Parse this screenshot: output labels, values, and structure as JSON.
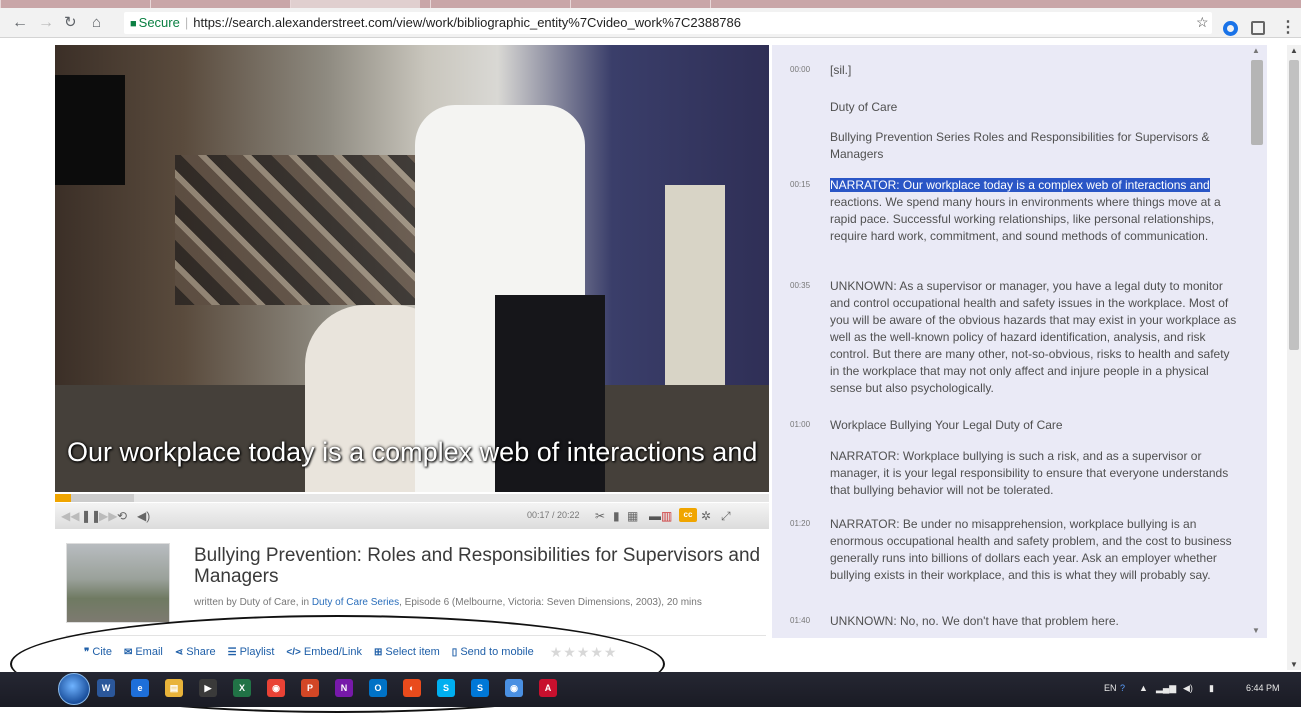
{
  "browser": {
    "secure_label": "Secure",
    "url": "https://search.alexanderstreet.com/view/work/bibliographic_entity%7Cvideo_work%7C2388786"
  },
  "video": {
    "subtitle": "Our workplace today is a complex web of interactions and",
    "progress": 0.0142,
    "buffered": 0.11,
    "time": "00:17 / 20:22",
    "cc_label": "cc"
  },
  "work": {
    "title": "Bullying Prevention: Roles and Responsibilities for Supervisors and Managers",
    "credit_prefix": "written by Duty of Care, in ",
    "series_link": "Duty of Care Series",
    "credit_suffix": ", Episode 6 (Melbourne, Victoria: Seven Dimensions, 2003), 20 mins"
  },
  "actions": {
    "cite": "Cite",
    "email": "Email",
    "share": "Share",
    "playlist": "Playlist",
    "embed": "Embed/Link",
    "select": "Select item",
    "mobile": "Send to mobile"
  },
  "rating": {
    "stars_filled": 0,
    "stars_total": 5
  },
  "transcript": [
    {
      "time": "00:00",
      "text": "[sil.]"
    },
    {
      "time": "",
      "text": "Duty of Care"
    },
    {
      "time": "",
      "text": "Bullying Prevention Series Roles and Responsibilities for Supervisors & Managers"
    },
    {
      "time": "00:15",
      "highlight": "NARRATOR: Our workplace today is a complex web of interactions and",
      "text": " reactions. We spend many hours in environments where things move at a rapid pace. Successful working relationships, like personal relationships, require hard work, commitment, and sound methods of communication."
    },
    {
      "time": "00:35",
      "text": "UNKNOWN: As a supervisor or manager, you have a legal duty to monitor and control occupational health and safety issues in the workplace. Most of you will be aware of the obvious hazards that may exist in your workplace as well as the well-known policy of hazard identification, analysis, and risk control. But there are many other, not-so-obvious, risks to health and safety in the workplace that may not only affect and injure people in a physical sense but also psychologically."
    },
    {
      "time": "01:00",
      "text": "Workplace Bullying Your Legal Duty of Care"
    },
    {
      "time": "",
      "text": "NARRATOR: Workplace bullying is such a risk, and as a supervisor or manager, it is your legal responsibility to ensure that everyone understands that bullying behavior will not be tolerated."
    },
    {
      "time": "01:20",
      "text": "NARRATOR: Be under no misapprehension, workplace bullying is an enormous occupational health and safety problem, and the cost to business generally runs into billions of dollars each year. Ask an employer whether bullying exists in their workplace, and this is what they will probably say."
    },
    {
      "time": "01:40",
      "text": "UNKNOWN: No, no. We don't have that problem here."
    }
  ],
  "taskbar": {
    "lang": "EN",
    "clock": "6:44 PM",
    "apps": [
      "word-icon",
      "ie-icon",
      "folder-icon",
      "media-icon",
      "excel-icon",
      "chrome-icon",
      "powerpoint-icon",
      "onenote-icon",
      "outlook-icon",
      "paint-icon",
      "skype-icon",
      "skype-business-icon",
      "chrome-alt-icon",
      "pdf-icon"
    ]
  },
  "colors": {
    "accent": "#f0a500",
    "link": "#1f5fa8",
    "transcript_bg": "#eaeaf6",
    "highlight": "#2a56c6"
  }
}
